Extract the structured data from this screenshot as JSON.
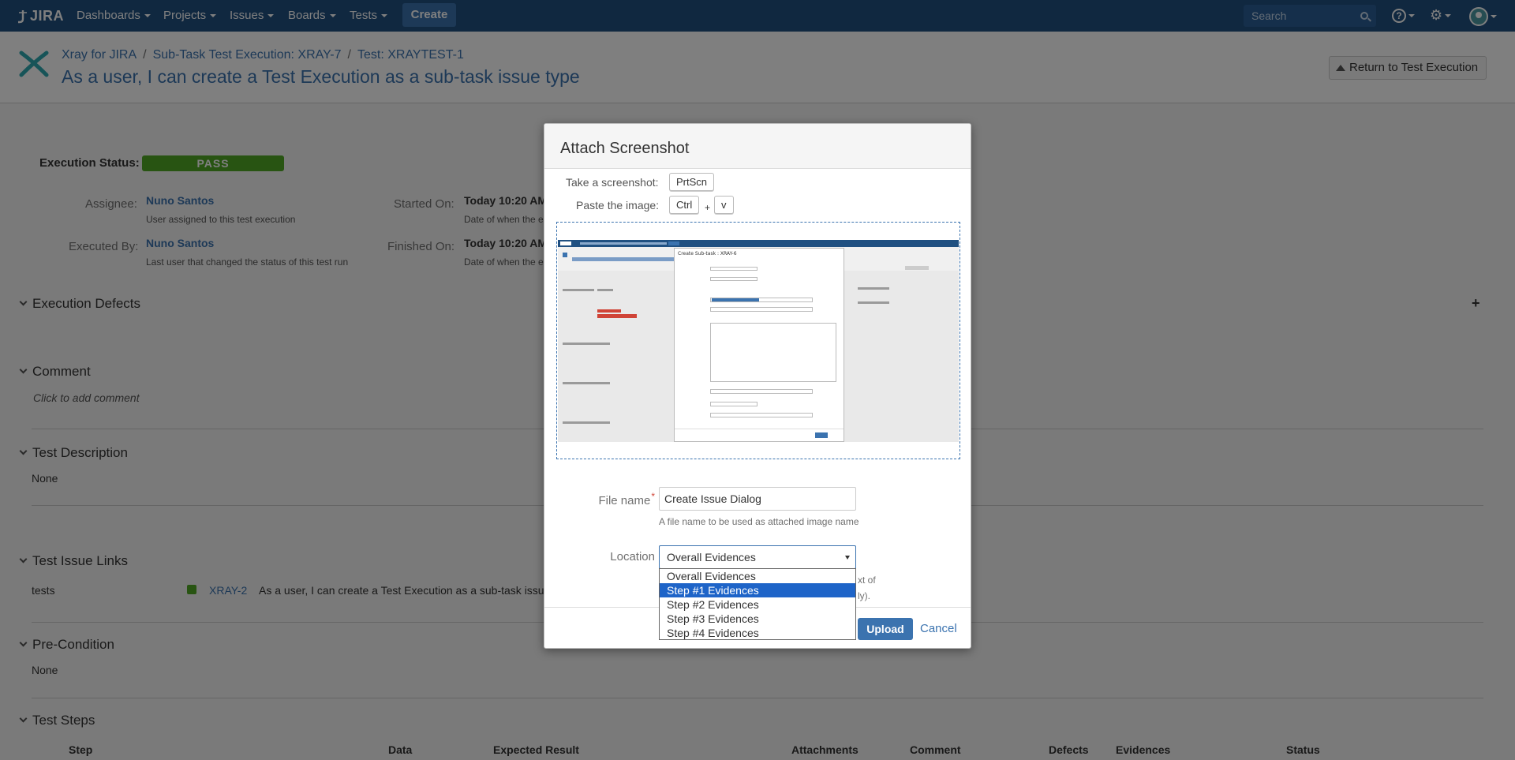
{
  "nav": {
    "logo": "JIRA",
    "items": [
      "Dashboards",
      "Projects",
      "Issues",
      "Boards",
      "Tests"
    ],
    "create": "Create",
    "search_placeholder": "Search"
  },
  "header": {
    "breadcrumbs": [
      "Xray for JIRA",
      "Sub-Task Test Execution: XRAY-7",
      "Test: XRAYTEST-1"
    ],
    "title": "As a user, I can create a Test Execution as a sub-task issue type",
    "return_button": "Return to Test Execution"
  },
  "execution": {
    "status_label": "Execution Status:",
    "status": "PASS",
    "assignee_label": "Assignee:",
    "assignee": "Nuno Santos",
    "assignee_desc": "User assigned to this test execution",
    "executed_by_label": "Executed By:",
    "executed_by": "Nuno Santos",
    "executed_by_desc": "Last user that changed the status of this test run",
    "started_label": "Started On:",
    "started": "Today 10:20 AM",
    "started_desc": "Date of when the e",
    "finished_label": "Finished On:",
    "finished": "Today 10:20 AM",
    "finished_desc": "Date of when the e"
  },
  "sections": {
    "defects": "Execution Defects",
    "comment": "Comment",
    "comment_placeholder": "Click to add comment",
    "description": "Test Description",
    "description_value": "None",
    "links": "Test Issue Links",
    "link_type": "tests",
    "link_key": "XRAY-2",
    "link_summary": "As a user, I can create a Test Execution as a sub-task issu",
    "precondition": "Pre-Condition",
    "precondition_value": "None",
    "steps": "Test Steps"
  },
  "steps_table": {
    "columns": [
      "Step",
      "Data",
      "Expected Result",
      "Attachments",
      "Comment",
      "Defects",
      "Evidences",
      "Status"
    ]
  },
  "dialog": {
    "title": "Attach Screenshot",
    "take_label": "Take a screenshot:",
    "take_key": "PrtScn",
    "paste_label": "Paste the image:",
    "paste_key1": "Ctrl",
    "paste_plus": "+",
    "paste_key2": "v",
    "preview_title": "Create Sub-task : XRAY-6",
    "filename_label": "File name",
    "filename_value": "Create Issue Dialog",
    "filename_desc": "A file name to be used as attached image name",
    "location_label": "Location",
    "location_value": "Overall Evidences",
    "location_options": [
      "Overall Evidences",
      "Step #1 Evidences",
      "Step #2 Evidences",
      "Step #3 Evidences",
      "Step #4 Evidences"
    ],
    "hidden_text_1": "xt of",
    "hidden_text_2": "ly).",
    "upload": "Upload",
    "cancel": "Cancel"
  }
}
